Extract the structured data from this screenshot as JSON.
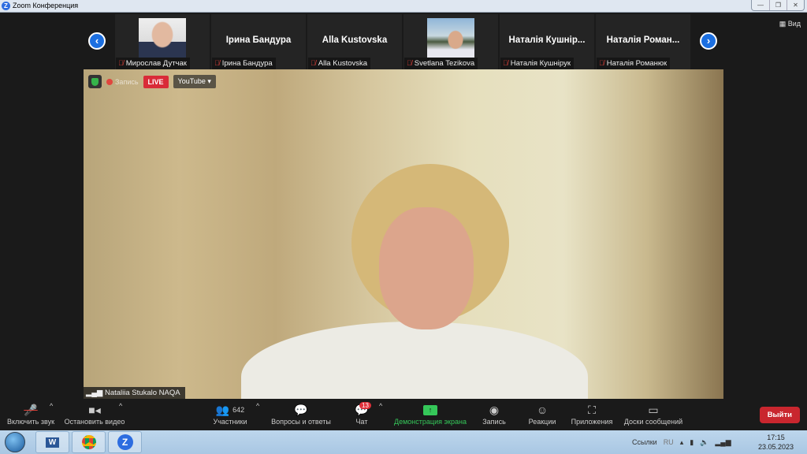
{
  "window": {
    "title": "Zoom Конференция",
    "controls": [
      "—",
      "❐",
      "✕"
    ]
  },
  "view_label": "Вид",
  "thumbnails": [
    {
      "label": "Мирослав Дутчак",
      "display": "",
      "photo": "man"
    },
    {
      "label": "Ірина Бандура",
      "display": "Ірина Бандура"
    },
    {
      "label": "Alla Kustovska",
      "display": "Alla Kustovska"
    },
    {
      "label": "Svetlana Tezikova",
      "display": "",
      "photo": "woman"
    },
    {
      "label": "Наталія Кушнірук",
      "display": "Наталія Кушнір..."
    },
    {
      "label": "Наталія Романюк",
      "display": "Наталія Роман..."
    }
  ],
  "overlay": {
    "recording": "Запись",
    "live": "LIVE",
    "stream": "YouTube ▾"
  },
  "speaker": "Nataliia Stukalo NAQA",
  "toolbar": {
    "unmute": "Включить звук",
    "stop_video": "Остановить видео",
    "participants": "Участники",
    "participants_count": "642",
    "qa": "Вопросы и ответы",
    "chat": "Чат",
    "chat_badge": "13",
    "share": "Демонстрация экрана",
    "record": "Запись",
    "reactions": "Реакции",
    "apps": "Приложения",
    "whiteboards": "Доски сообщений",
    "leave": "Выйти"
  },
  "taskbar": {
    "links": "Ссылки",
    "lang": "RU",
    "time": "17:15",
    "date": "23.05.2023"
  },
  "colors": {
    "accent": "#1c6fe0",
    "share": "#35c759",
    "leave": "#c9262e"
  }
}
